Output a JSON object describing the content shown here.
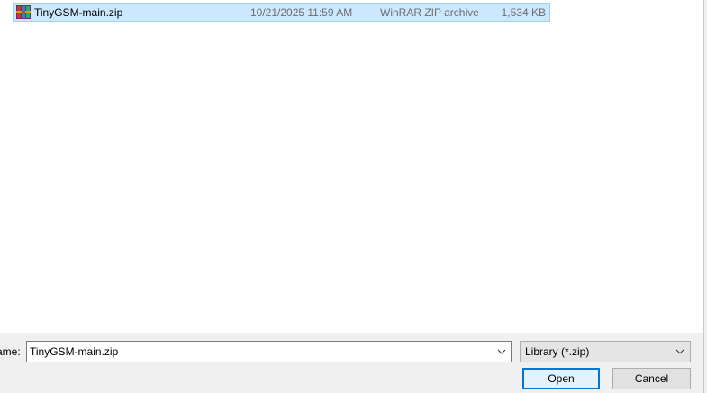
{
  "file_list": {
    "items": [
      {
        "name": "TinyGSM-main.zip",
        "date_modified": "10/21/2025 11:59 AM",
        "type": "WinRAR ZIP archive",
        "size": "1,534 KB",
        "icon": "winrar-archive-icon",
        "selected": true
      }
    ]
  },
  "footer": {
    "filename_label_prefix": "",
    "filename_label_tail": "ame:",
    "filename_value": "TinyGSM-main.zip",
    "filetype_selected": "Library (*.zip)",
    "open_label": "Open",
    "cancel_label": "Cancel"
  },
  "colors": {
    "selection_bg": "#cce8ff",
    "selection_border": "#99d1ff",
    "accent": "#0078d7"
  }
}
